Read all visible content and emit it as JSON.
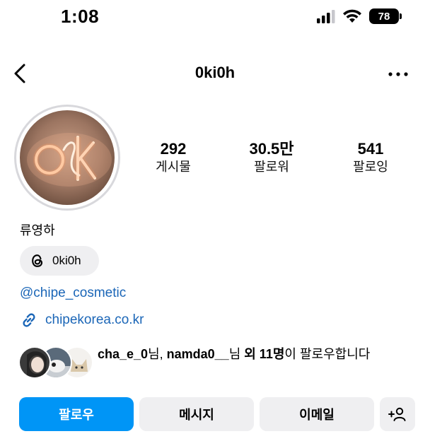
{
  "status_bar": {
    "time": "1:08",
    "battery": "78"
  },
  "header": {
    "username": "0ki0h"
  },
  "stats": [
    {
      "value": "292",
      "label": "게시물"
    },
    {
      "value": "30.5만",
      "label": "팔로워"
    },
    {
      "value": "541",
      "label": "팔로잉"
    }
  ],
  "profile": {
    "display_name": "류영하",
    "threads_handle": "0ki0h",
    "mention": "@chipe_cosmetic",
    "link": "chipekorea.co.kr"
  },
  "followed_by": {
    "user1": "cha_e_0",
    "suffix1": "님, ",
    "user2": "namda0__",
    "suffix2": "님 ",
    "others": "외 11명",
    "tail": "이 팔로우합니다"
  },
  "actions": {
    "follow": "팔로우",
    "message": "메시지",
    "email": "이메일"
  },
  "colors": {
    "accent": "#0095f6",
    "link": "#1b66b7",
    "button_bg": "#efeff1"
  },
  "icons": [
    "back-arrow-icon",
    "more-icon",
    "threads-icon",
    "link-icon",
    "add-person-icon",
    "signal-icon",
    "wifi-icon",
    "battery-icon"
  ]
}
